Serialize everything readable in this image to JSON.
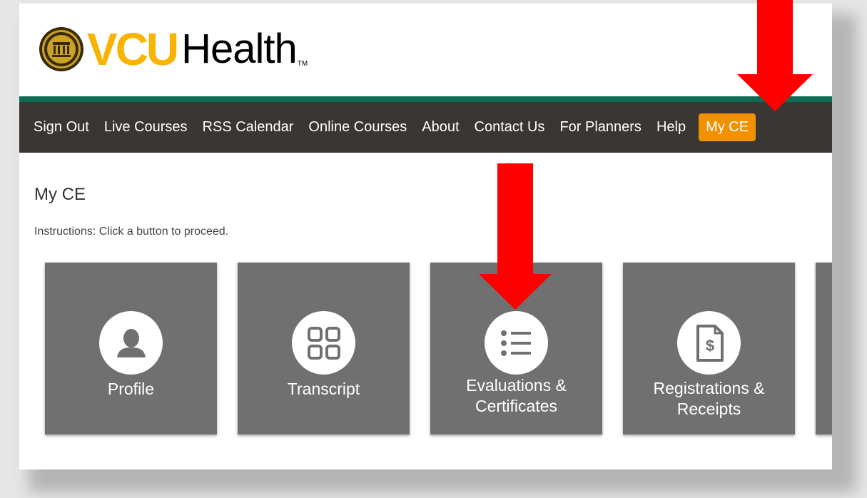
{
  "header": {
    "logo_vcu": "VCU",
    "logo_health": "Health",
    "logo_tm": "TM",
    "seal_text": "VIRGINIA COMMONWEALTH UNIVERSITY 1838"
  },
  "nav": {
    "items": [
      {
        "label": "Sign Out"
      },
      {
        "label": "Live Courses"
      },
      {
        "label": "RSS Calendar"
      },
      {
        "label": "Online Courses"
      },
      {
        "label": "About"
      },
      {
        "label": "Contact Us"
      },
      {
        "label": "For Planners"
      },
      {
        "label": "Help"
      },
      {
        "label": "My CE"
      }
    ],
    "active": "My CE"
  },
  "main": {
    "title": "My CE",
    "instructions": "Instructions: Click a button to proceed.",
    "tiles": [
      {
        "label_line1": "Profile",
        "label_line2": "",
        "icon": "person-icon"
      },
      {
        "label_line1": "Transcript",
        "label_line2": "",
        "icon": "grid-icon"
      },
      {
        "label_line1": "Evaluations &",
        "label_line2": "Certificates",
        "icon": "list-icon"
      },
      {
        "label_line1": "Registrations &",
        "label_line2": "Receipts",
        "icon": "receipt-dollar-icon"
      }
    ]
  },
  "colors": {
    "brand_gold": "#f8b400",
    "accent_green": "#0f6b54",
    "nav_bg": "#393633",
    "active_orange": "#f29100",
    "tile_gray": "#707070",
    "arrow_red": "#ff0000"
  }
}
